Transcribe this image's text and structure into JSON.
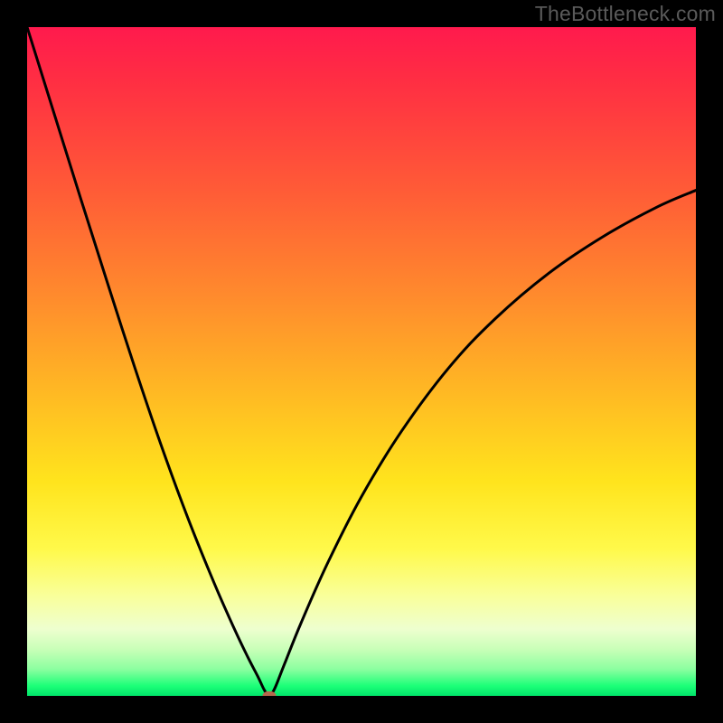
{
  "watermark": "TheBottleneck.com",
  "chart_data": {
    "type": "line",
    "title": "",
    "xlabel": "",
    "ylabel": "",
    "xlim": [
      0,
      100
    ],
    "ylim": [
      0,
      100
    ],
    "grid": false,
    "legend": false,
    "series": [
      {
        "name": "curve",
        "x": [
          0,
          2,
          5,
          8,
          12,
          16,
          20,
          24,
          28,
          31,
          33,
          34.5,
          35.3,
          35.8,
          36.2,
          36.6,
          37.2,
          38.5,
          41,
          45,
          50,
          56,
          63,
          70,
          78,
          86,
          94,
          100
        ],
        "y": [
          100,
          93.6,
          84,
          74.4,
          61.8,
          49.4,
          37.6,
          26.7,
          16.8,
          10.0,
          5.8,
          2.9,
          1.2,
          0.35,
          0.0,
          0.35,
          1.5,
          4.8,
          11.0,
          20.0,
          29.8,
          39.6,
          49.0,
          56.4,
          63.2,
          68.6,
          73.0,
          75.6
        ]
      }
    ],
    "marker": {
      "x": 36.2,
      "y": 0.0
    },
    "background_gradient": {
      "top": "#ff1a4d",
      "mid": "#ffe41d",
      "bottom": "#00e46a"
    }
  }
}
